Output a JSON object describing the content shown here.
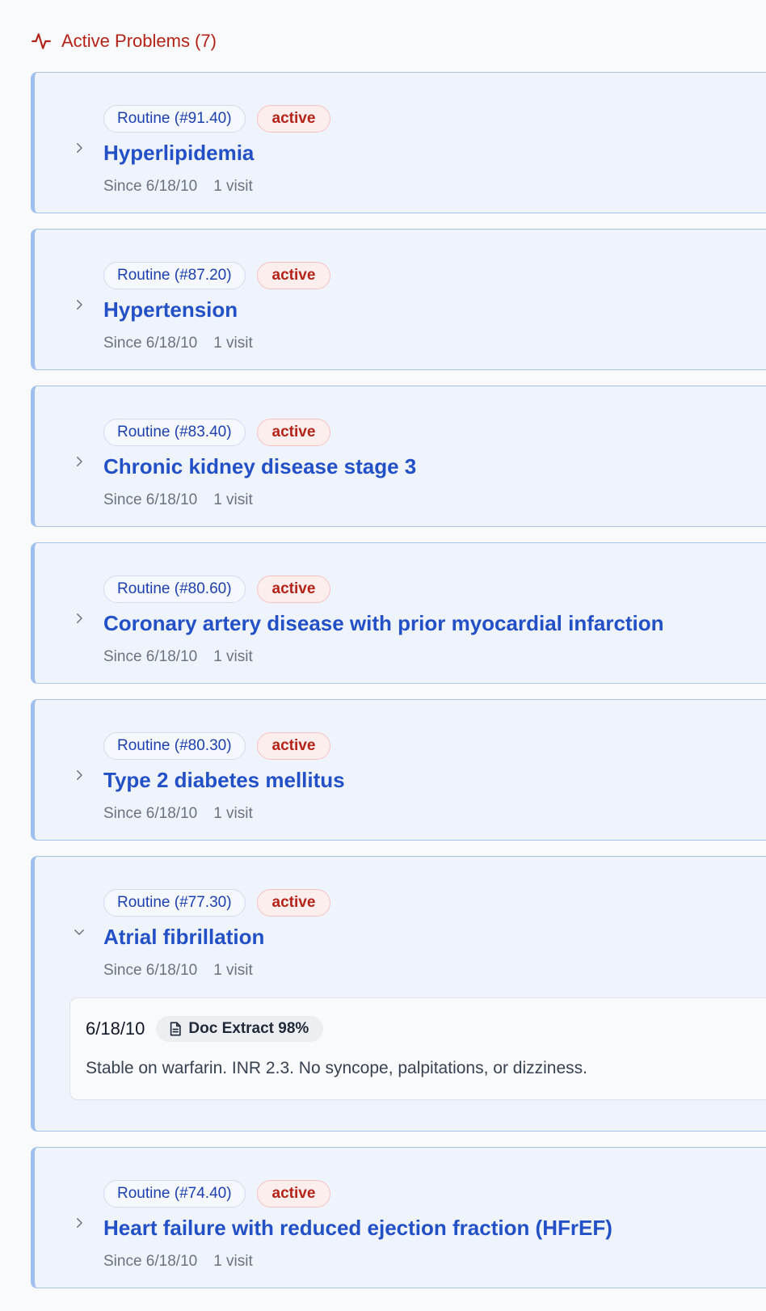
{
  "section": {
    "icon": "activity-icon",
    "title": "Active Problems (7)",
    "accent_color": "#b42318"
  },
  "problems": [
    {
      "routine": "Routine (#91.40)",
      "status": "active",
      "name": "Hyperlipidemia",
      "since": "Since 6/18/10",
      "visits": "1 visit",
      "expanded": false
    },
    {
      "routine": "Routine (#87.20)",
      "status": "active",
      "name": "Hypertension",
      "since": "Since 6/18/10",
      "visits": "1 visit",
      "expanded": false
    },
    {
      "routine": "Routine (#83.40)",
      "status": "active",
      "name": "Chronic kidney disease stage 3",
      "since": "Since 6/18/10",
      "visits": "1 visit",
      "expanded": false
    },
    {
      "routine": "Routine (#80.60)",
      "status": "active",
      "name": "Coronary artery disease with prior myocardial infarction",
      "since": "Since 6/18/10",
      "visits": "1 visit",
      "expanded": false
    },
    {
      "routine": "Routine (#80.30)",
      "status": "active",
      "name": "Type 2 diabetes mellitus",
      "since": "Since 6/18/10",
      "visits": "1 visit",
      "expanded": false
    },
    {
      "routine": "Routine (#77.30)",
      "status": "active",
      "name": "Atrial fibrillation",
      "since": "Since 6/18/10",
      "visits": "1 visit",
      "expanded": true,
      "note": {
        "date": "6/18/10",
        "source_icon": "document-icon",
        "source": "Doc Extract 98%",
        "text": "Stable on warfarin. INR 2.3. No syncope, palpitations, or dizziness."
      }
    },
    {
      "routine": "Routine (#74.40)",
      "status": "active",
      "name": "Heart failure with reduced ejection fraction (HFrEF)",
      "since": "Since 6/18/10",
      "visits": "1 visit",
      "expanded": false
    }
  ]
}
